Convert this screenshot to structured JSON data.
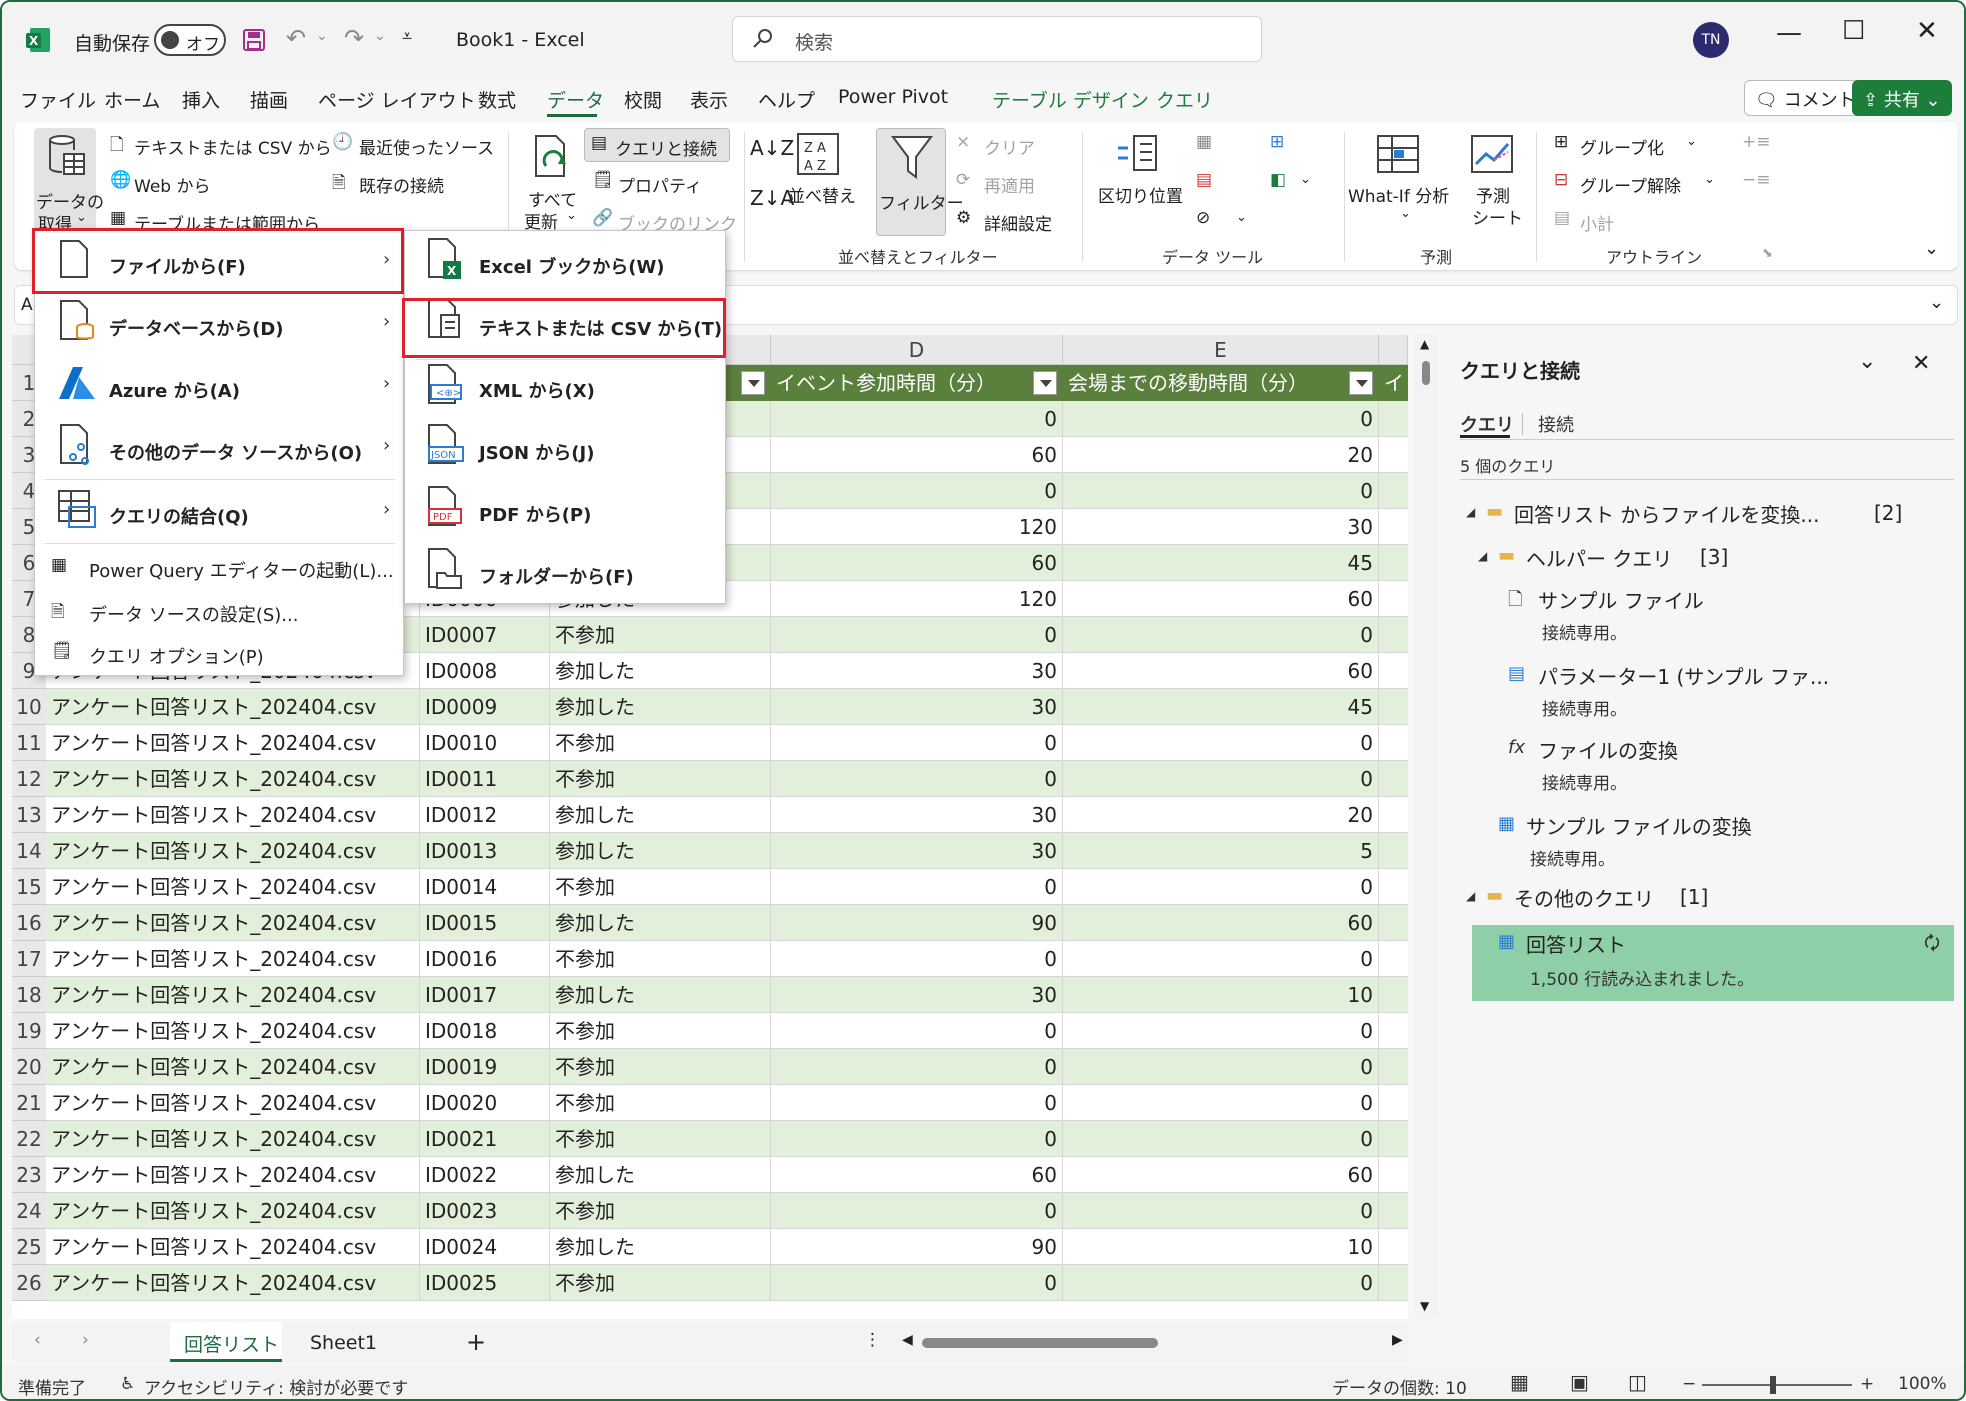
{
  "window": {
    "app_label": "自動保存",
    "toggle": "オフ",
    "title": "Book1  -  Excel",
    "search_placeholder": "検索",
    "user_initials": "TN"
  },
  "tabs": [
    "ファイル",
    "ホーム",
    "挿入",
    "描画",
    "ページ レイアウト",
    "数式",
    "データ",
    "校閲",
    "表示",
    "ヘルプ",
    "Power Pivot",
    "テーブル デザイン",
    "クエリ"
  ],
  "active_tab": "データ",
  "top_right": {
    "comment": "コメント",
    "share": "共有"
  },
  "ribbon": {
    "get_data": "データの\n取得",
    "get_data_l1": "データの",
    "get_data_l2": "取得",
    "text_csv": "テキストまたは CSV から",
    "web": "Web から",
    "table_range": "テーブルまたは範囲から",
    "recent_sources": "最近使ったソース",
    "existing_conn": "既存の接続",
    "refresh_all_l1": "すべて",
    "refresh_all_l2": "更新",
    "queries_conn": "クエリと接続",
    "properties": "プロパティ",
    "book_links": "ブックのリンク",
    "sort": "並べ替え",
    "filter": "フィルター",
    "clear": "クリア",
    "reapply": "再適用",
    "advanced": "詳細設定",
    "group_sort_filter": "並べ替えとフィルター",
    "split": "区切り位置",
    "group_data_tools": "データ ツール",
    "whatif": "What-If 分析",
    "forecast_l1": "予測",
    "forecast_l2": "シート",
    "group_forecast": "予測",
    "group": "グループ化",
    "ungroup": "グループ解除",
    "subtotal": "小計",
    "group_outline": "アウトライン"
  },
  "namebox": "A",
  "file_menu": {
    "items": [
      {
        "label": "ファイルから(F)"
      },
      {
        "label": "データベースから(D)"
      },
      {
        "label": "Azure から(A)"
      },
      {
        "label": "その他のデータ ソースから(O)"
      },
      {
        "label": "クエリの結合(Q)"
      },
      {
        "label": "Power Query エディターの起動(L)..."
      },
      {
        "label": "データ ソースの設定(S)..."
      },
      {
        "label": "クエリ オプション(P)"
      }
    ]
  },
  "sub_menu": {
    "items": [
      {
        "label": "Excel ブックから(W)"
      },
      {
        "label": "テキストまたは CSV から(T)"
      },
      {
        "label": "XML から(X)"
      },
      {
        "label": "JSON から(J)"
      },
      {
        "label": "PDF から(P)"
      },
      {
        "label": "フォルダーから(F)"
      }
    ]
  },
  "grid": {
    "col_letters": [
      "D",
      "E"
    ],
    "header_d": "イベント参加時間（分）",
    "header_e": "会場までの移動時間（分）",
    "header_f": "イ",
    "rows": [
      {
        "n": "1"
      },
      {
        "n": "2",
        "a": "",
        "b": "",
        "c": "",
        "d": "0",
        "e": "0"
      },
      {
        "n": "3",
        "a": "",
        "b": "",
        "c": "",
        "d": "60",
        "e": "20"
      },
      {
        "n": "4",
        "a": "",
        "b": "",
        "c": "",
        "d": "0",
        "e": "0"
      },
      {
        "n": "5",
        "a": "",
        "b": "",
        "c": "",
        "d": "120",
        "e": "30"
      },
      {
        "n": "6",
        "a": "",
        "b": "",
        "c": "",
        "d": "60",
        "e": "45"
      },
      {
        "n": "7",
        "a": "",
        "b": "ID0006",
        "c": "参加した",
        "d": "120",
        "e": "60"
      },
      {
        "n": "8",
        "a": "",
        "b": "ID0007",
        "c": "不参加",
        "d": "0",
        "e": "0"
      },
      {
        "n": "9",
        "a": "アンケート回答リスト_202404.csv",
        "b": "ID0008",
        "c": "参加した",
        "d": "30",
        "e": "60"
      },
      {
        "n": "10",
        "a": "アンケート回答リスト_202404.csv",
        "b": "ID0009",
        "c": "参加した",
        "d": "30",
        "e": "45"
      },
      {
        "n": "11",
        "a": "アンケート回答リスト_202404.csv",
        "b": "ID0010",
        "c": "不参加",
        "d": "0",
        "e": "0"
      },
      {
        "n": "12",
        "a": "アンケート回答リスト_202404.csv",
        "b": "ID0011",
        "c": "不参加",
        "d": "0",
        "e": "0"
      },
      {
        "n": "13",
        "a": "アンケート回答リスト_202404.csv",
        "b": "ID0012",
        "c": "参加した",
        "d": "30",
        "e": "20"
      },
      {
        "n": "14",
        "a": "アンケート回答リスト_202404.csv",
        "b": "ID0013",
        "c": "参加した",
        "d": "30",
        "e": "5"
      },
      {
        "n": "15",
        "a": "アンケート回答リスト_202404.csv",
        "b": "ID0014",
        "c": "不参加",
        "d": "0",
        "e": "0"
      },
      {
        "n": "16",
        "a": "アンケート回答リスト_202404.csv",
        "b": "ID0015",
        "c": "参加した",
        "d": "90",
        "e": "60"
      },
      {
        "n": "17",
        "a": "アンケート回答リスト_202404.csv",
        "b": "ID0016",
        "c": "不参加",
        "d": "0",
        "e": "0"
      },
      {
        "n": "18",
        "a": "アンケート回答リスト_202404.csv",
        "b": "ID0017",
        "c": "参加した",
        "d": "30",
        "e": "10"
      },
      {
        "n": "19",
        "a": "アンケート回答リスト_202404.csv",
        "b": "ID0018",
        "c": "不参加",
        "d": "0",
        "e": "0"
      },
      {
        "n": "20",
        "a": "アンケート回答リスト_202404.csv",
        "b": "ID0019",
        "c": "不参加",
        "d": "0",
        "e": "0"
      },
      {
        "n": "21",
        "a": "アンケート回答リスト_202404.csv",
        "b": "ID0020",
        "c": "不参加",
        "d": "0",
        "e": "0"
      },
      {
        "n": "22",
        "a": "アンケート回答リスト_202404.csv",
        "b": "ID0021",
        "c": "不参加",
        "d": "0",
        "e": "0"
      },
      {
        "n": "23",
        "a": "アンケート回答リスト_202404.csv",
        "b": "ID0022",
        "c": "参加した",
        "d": "60",
        "e": "60"
      },
      {
        "n": "24",
        "a": "アンケート回答リスト_202404.csv",
        "b": "ID0023",
        "c": "不参加",
        "d": "0",
        "e": "0"
      },
      {
        "n": "25",
        "a": "アンケート回答リスト_202404.csv",
        "b": "ID0024",
        "c": "参加した",
        "d": "90",
        "e": "10"
      },
      {
        "n": "26",
        "a": "アンケート回答リスト_202404.csv",
        "b": "ID0025",
        "c": "不参加",
        "d": "0",
        "e": "0"
      }
    ]
  },
  "pane": {
    "title": "クエリと接続",
    "tab_queries": "クエリ",
    "tab_connections": "接続",
    "count": "5 個のクエリ",
    "folder1": "回答リスト からファイルを変換...",
    "folder1_count": "[2]",
    "folder2": "ヘルパー クエリ",
    "folder2_count": "[3]",
    "q1": "サンプル ファイル",
    "q1_sub": "接続専用。",
    "q2": "パラメーター1 (サンプル ファ...",
    "q2_sub": "接続専用。",
    "q3": "ファイルの変換",
    "q3_sub": "接続専用。",
    "q4": "サンプル ファイルの変換",
    "q4_sub": "接続専用。",
    "folder3": "その他のクエリ",
    "folder3_count": "[1]",
    "q5": "回答リスト",
    "q5_sub": "1,500 行読み込まれました。"
  },
  "sheets": [
    "回答リスト",
    "Sheet1"
  ],
  "status": {
    "ready": "準備完了",
    "accessibility": "アクセシビリティ: 検討が必要です",
    "count": "データの個数: 10",
    "zoom": "100%"
  },
  "colors": {
    "accent": "#1d6b3f",
    "table_header": "#5b7f3d",
    "band": "#e2efda",
    "highlight": "#e0202a",
    "selected_query": "#8fcfa8"
  }
}
